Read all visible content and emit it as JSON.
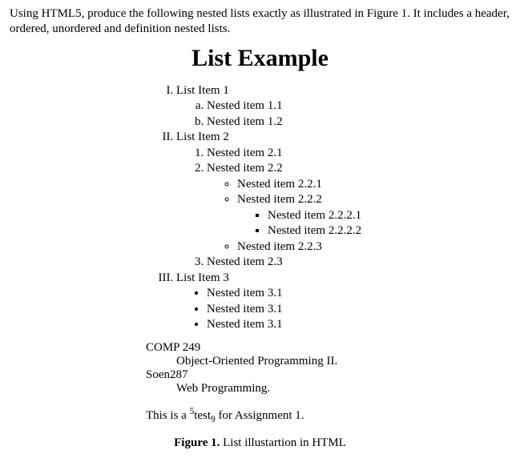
{
  "intro": "Using HTML5, produce the following nested lists exactly as illustrated in Figure 1. It includes a header, ordered, unordered and definition nested lists.",
  "heading": "List Example",
  "ol": {
    "i1": "List Item 1",
    "i1a": "Nested item 1.1",
    "i1b": "Nested item 1.2",
    "i2": "List Item 2",
    "i2_1": "Nested item 2.1",
    "i2_2": "Nested item 2.2",
    "i2_2_1": "Nested item 2.2.1",
    "i2_2_2": "Nested item 2.2.2",
    "i2_2_2_1": "Nested item 2.2.2.1",
    "i2_2_2_2": "Nested item 2.2.2.2",
    "i2_2_3": "Nested item 2.2.3",
    "i2_3": "Nested item 2.3",
    "i3": "List Item 3",
    "i3_1": "Nested item 3.1",
    "i3_2": "Nested item 3.1",
    "i3_3": "Nested item 3.1"
  },
  "dl": {
    "t1": "COMP 249",
    "d1": "Object-Oriented Programming II.",
    "t2": "Soen287",
    "d2": "Web Programming."
  },
  "note": {
    "p1": "This is a ",
    "sup": "5",
    "mid": "test",
    "sub": "9",
    "p2": " for Assignment 1."
  },
  "caption": {
    "label": "Figure 1.",
    "text": " List illustartion in HTML"
  }
}
